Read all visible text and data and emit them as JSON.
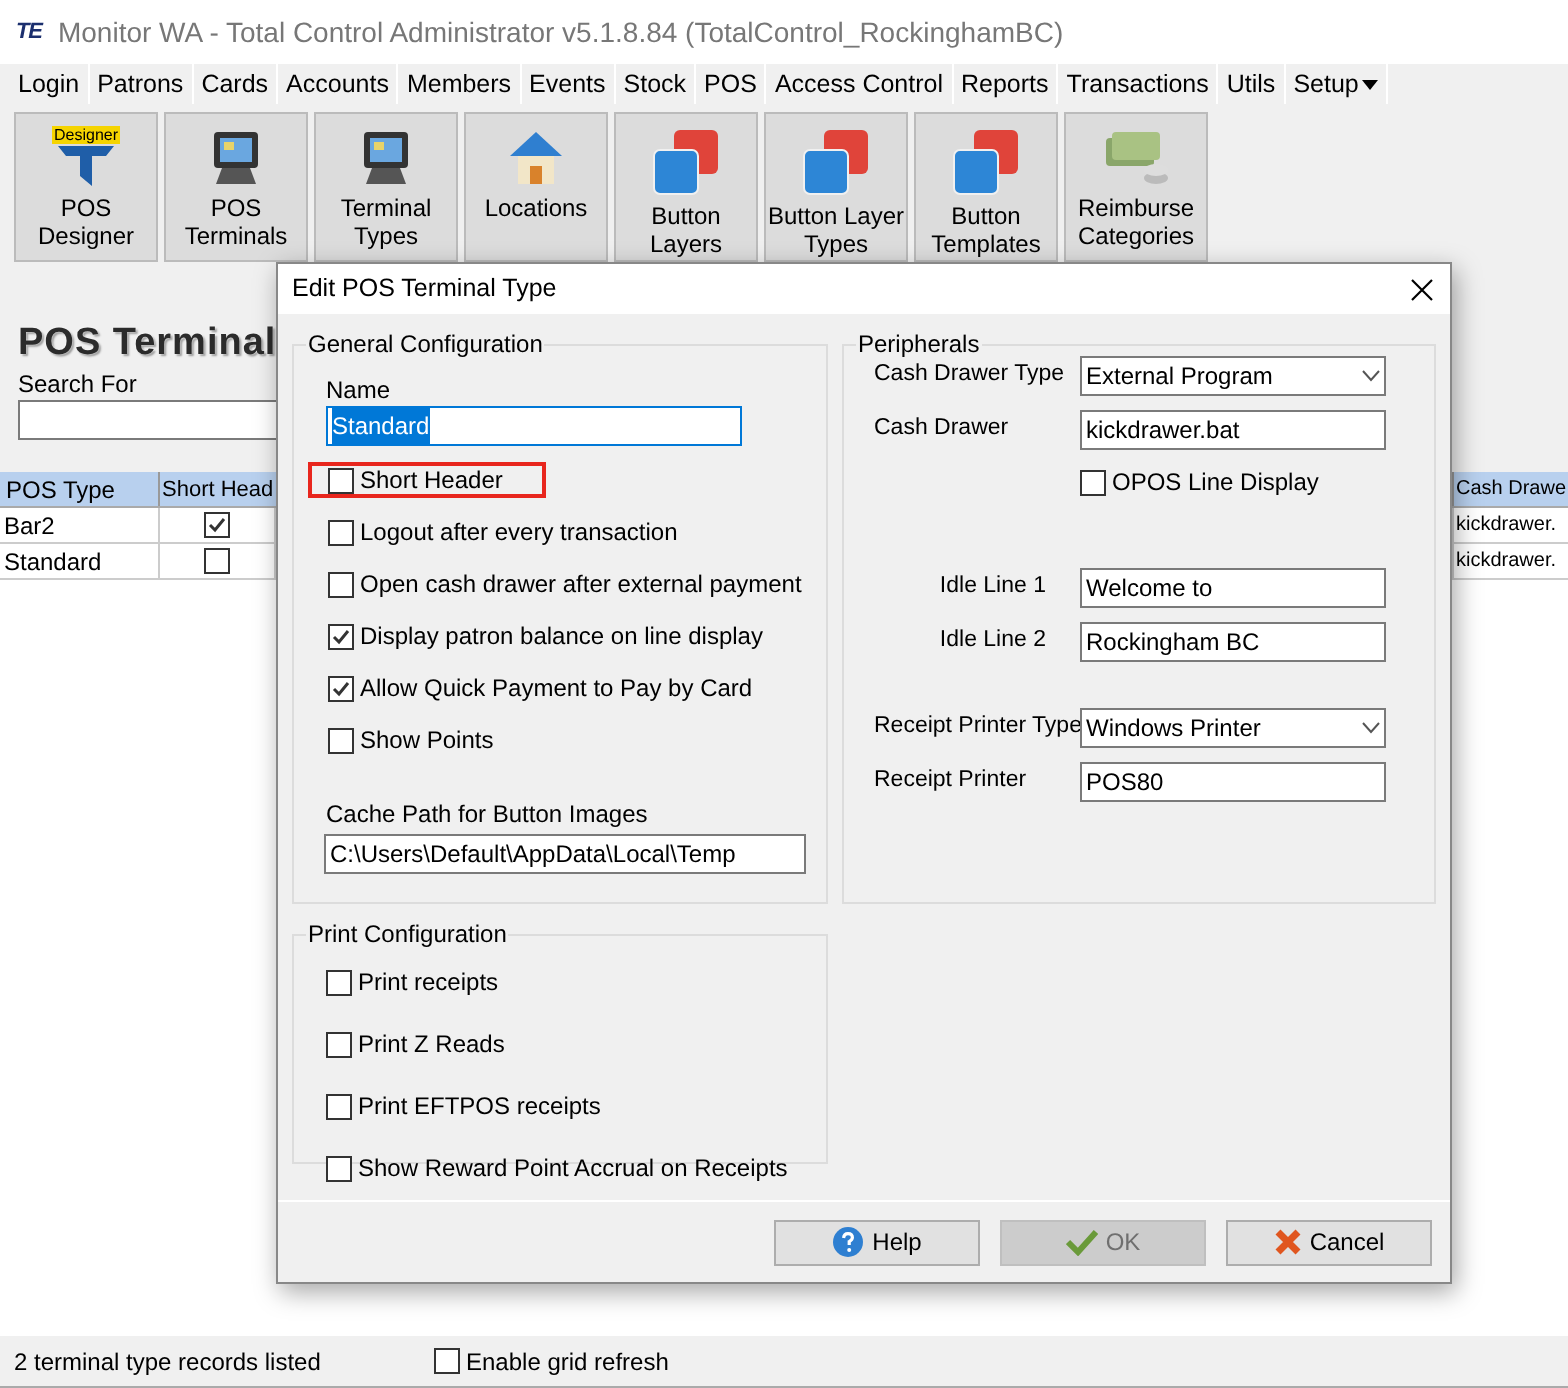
{
  "window": {
    "logo": "TE",
    "title": "Monitor WA - Total Control Administrator v5.1.8.84 (TotalControl_RockinghamBC)"
  },
  "menu": [
    {
      "label": "Login",
      "kind": "plain"
    },
    {
      "label": "Patrons",
      "kind": "plain"
    },
    {
      "label": "Cards",
      "kind": "plain"
    },
    {
      "label": "Accounts",
      "kind": "plain"
    },
    {
      "label": "Members",
      "kind": "plain"
    },
    {
      "label": "Events",
      "kind": "plain"
    },
    {
      "label": "Stock",
      "kind": "plain"
    },
    {
      "label": "POS",
      "kind": "plain"
    },
    {
      "label": "Access Control",
      "kind": "plain"
    },
    {
      "label": "Reports",
      "kind": "plain"
    },
    {
      "label": "Transactions",
      "kind": "plain"
    },
    {
      "label": "Utils",
      "kind": "plain"
    },
    {
      "label": "Setup",
      "kind": "dropdown"
    }
  ],
  "toolbar": [
    {
      "label": "POS Designer",
      "kind": "designer",
      "badge": "Designer"
    },
    {
      "label": "POS Terminals",
      "kind": "terminal"
    },
    {
      "label": "Terminal Types",
      "kind": "terminal"
    },
    {
      "label": "Locations",
      "kind": "house"
    },
    {
      "label": "Button Layers",
      "kind": "layers"
    },
    {
      "label": "Button Layer Types",
      "kind": "layers"
    },
    {
      "label": "Button Templates",
      "kind": "layers"
    },
    {
      "label": "Reimburse Categories",
      "kind": "money"
    }
  ],
  "page": {
    "heading": "POS Terminal",
    "search_label": "Search For"
  },
  "grid": {
    "columns": [
      "POS Type",
      "Short Head",
      "Cash Drawe"
    ],
    "rows": [
      {
        "pos_type": "Bar2",
        "short_header": true,
        "cash_drawer": "kickdrawer."
      },
      {
        "pos_type": "Standard",
        "short_header": false,
        "cash_drawer": "kickdrawer."
      }
    ]
  },
  "dialog": {
    "title": "Edit POS Terminal Type",
    "general": {
      "title": "General Configuration",
      "name_label": "Name",
      "name_value": "Standard",
      "options": [
        {
          "label": "Short Header",
          "checked": false,
          "highlighted": true
        },
        {
          "label": "Logout after every transaction",
          "checked": false,
          "highlighted": false
        },
        {
          "label": "Open cash drawer after external payment",
          "checked": false,
          "highlighted": false
        },
        {
          "label": "Display patron balance on line display",
          "checked": true,
          "highlighted": false
        },
        {
          "label": "Allow Quick Payment to Pay by Card",
          "checked": true,
          "highlighted": false
        },
        {
          "label": "Show Points",
          "checked": false,
          "highlighted": false
        }
      ],
      "cache_label": "Cache Path for Button Images",
      "cache_value": "C:\\Users\\Default\\AppData\\Local\\Temp"
    },
    "peripherals": {
      "title": "Peripherals",
      "rows": [
        {
          "kind": "select",
          "label": "Cash Drawer Type",
          "value": "External Program"
        },
        {
          "kind": "input",
          "label": "Cash Drawer",
          "value": "kickdrawer.bat"
        },
        {
          "kind": "checkbox",
          "label": "OPOS Line Display",
          "checked": false
        },
        {
          "kind": "input",
          "label": "Idle Line 1",
          "value": "Welcome to"
        },
        {
          "kind": "input",
          "label": "Idle Line 2",
          "value": "Rockingham BC"
        },
        {
          "kind": "select",
          "label": "Receipt Printer Type",
          "value": "Windows Printer"
        },
        {
          "kind": "input",
          "label": "Receipt Printer",
          "value": "POS80"
        }
      ]
    },
    "print": {
      "title": "Print Configuration",
      "options": [
        {
          "label": "Print receipts",
          "checked": false
        },
        {
          "label": "Print Z Reads",
          "checked": false
        },
        {
          "label": "Print EFTPOS receipts",
          "checked": false
        },
        {
          "label": "Show Reward Point Accrual on Receipts",
          "checked": false
        }
      ]
    },
    "buttons": [
      {
        "label": "Help",
        "kind": "help",
        "disabled": false
      },
      {
        "label": "OK",
        "kind": "ok",
        "disabled": true
      },
      {
        "label": "Cancel",
        "kind": "cancel",
        "disabled": false
      }
    ]
  },
  "status_bar": {
    "text": "2 terminal type records listed",
    "grid_refresh": {
      "label": "Enable grid refresh",
      "checked": false
    }
  }
}
